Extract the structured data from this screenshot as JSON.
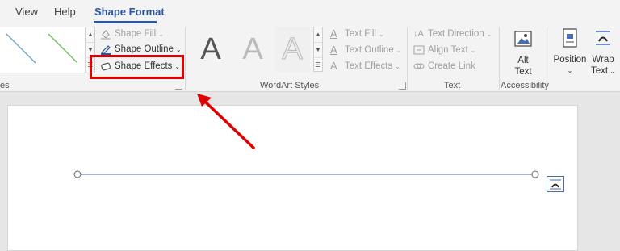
{
  "tabs": [
    {
      "label": "View"
    },
    {
      "label": "Help"
    },
    {
      "label": "Shape Format"
    }
  ],
  "shape_styles": {
    "fill_label": "Shape Fill",
    "outline_label": "Shape Outline",
    "effects_label": "Shape Effects",
    "group_label_partial": "es"
  },
  "wordart": {
    "letters": [
      "A",
      "A",
      "A"
    ],
    "text_fill_label": "Text Fill",
    "text_outline_label": "Text Outline",
    "text_effects_label": "Text Effects",
    "group_label": "WordArt Styles"
  },
  "text_group": {
    "direction_label": "Text Direction",
    "align_label": "Align Text",
    "link_label": "Create Link",
    "group_label": "Text"
  },
  "accessibility": {
    "alt_text_line1": "Alt",
    "alt_text_line2": "Text",
    "group_label": "Accessibility"
  },
  "arrange": {
    "position_label": "Position",
    "wrap_line1": "Wrap",
    "wrap_line2": "Text"
  },
  "colors": {
    "accent": "#2b579a",
    "highlight": "#e00000",
    "line": "#4a6db0"
  }
}
